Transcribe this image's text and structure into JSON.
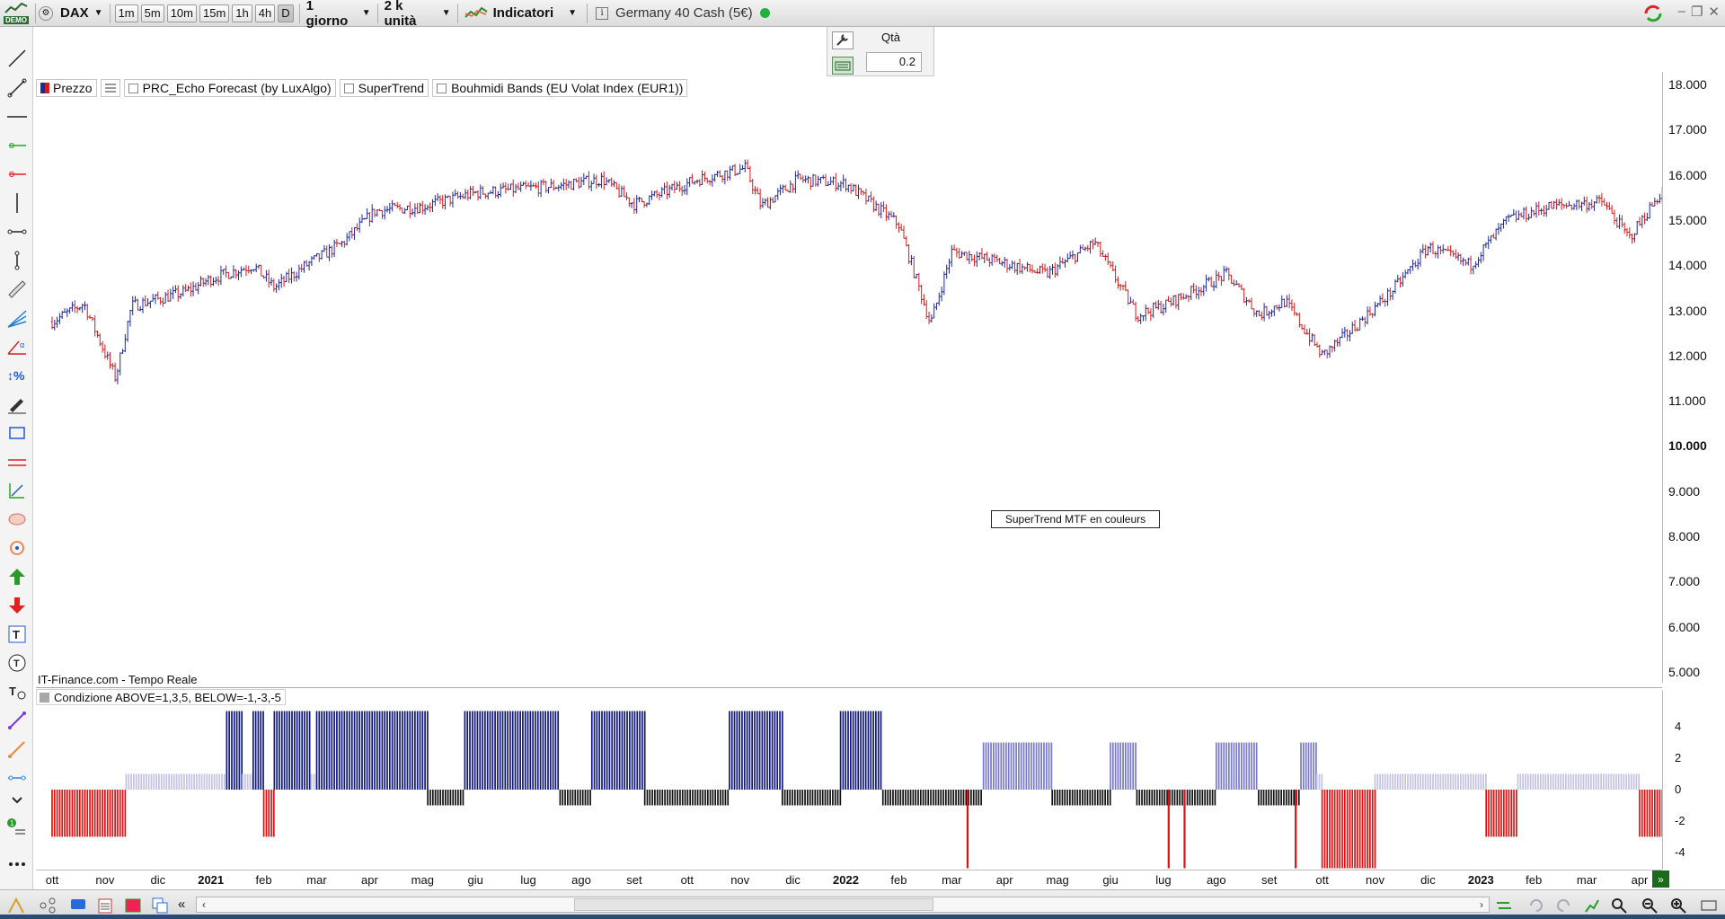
{
  "toolbar": {
    "logo_text": "DEMO",
    "instrument_dropdown": "DAX",
    "timeframes": [
      "1m",
      "5m",
      "10m",
      "15m",
      "1h",
      "4h",
      "D"
    ],
    "active_timeframe": "D",
    "period_dropdown": "1 giorno",
    "units_dropdown": "2 k unità",
    "indicators_label": "Indicatori",
    "instrument_name": "Germany 40 Cash (5€)",
    "status_color": "#22b13a"
  },
  "order_panel": {
    "qta_label": "Qtà",
    "qta_value": "0.2"
  },
  "legend": {
    "price_label": "Prezzo",
    "indicators": [
      "PRC_Echo Forecast (by LuxAlgo)",
      "SuperTrend",
      "Bouhmidi Bands (EU Volat Index (EUR1))"
    ]
  },
  "price_axis": [
    {
      "label": "18.000",
      "value": 18000
    },
    {
      "label": "17.000",
      "value": 17000
    },
    {
      "label": "16.000",
      "value": 16000
    },
    {
      "label": "15.000",
      "value": 15000
    },
    {
      "label": "14.000",
      "value": 14000
    },
    {
      "label": "13.000",
      "value": 13000
    },
    {
      "label": "12.000",
      "value": 12000
    },
    {
      "label": "11.000",
      "value": 11000
    },
    {
      "label": "10.000",
      "value": 10000
    },
    {
      "label": "9.000",
      "value": 9000
    },
    {
      "label": "8.000",
      "value": 8000
    },
    {
      "label": "7.000",
      "value": 7000
    },
    {
      "label": "6.000",
      "value": 6000
    },
    {
      "label": "5.000",
      "value": 5000
    }
  ],
  "supertrend_label": "SuperTrend MTF en couleurs",
  "source_label": "IT-Finance.com - Tempo Reale",
  "indicator_panel": {
    "label": "Condizione ABOVE=1,3,5, BELOW=-1,-3,-5",
    "axis": [
      {
        "label": "4",
        "value": 4
      },
      {
        "label": "2",
        "value": 2
      },
      {
        "label": "0",
        "value": 0
      },
      {
        "label": "-2",
        "value": -2
      },
      {
        "label": "-4",
        "value": -4
      }
    ]
  },
  "time_axis": [
    "ott",
    "nov",
    "dic",
    "2021",
    "feb",
    "mar",
    "apr",
    "mag",
    "giu",
    "lug",
    "ago",
    "set",
    "ott",
    "nov",
    "dic",
    "2022",
    "feb",
    "mar",
    "apr",
    "mag",
    "giu",
    "lug",
    "ago",
    "set",
    "ott",
    "nov",
    "dic",
    "2023",
    "feb",
    "mar",
    "apr"
  ],
  "colors": {
    "bull": "#1c2a9c",
    "bear": "#d21c1c",
    "cond_5": "#10187a",
    "cond_3": "#7a7ac8",
    "cond_1": "#c2c2e2",
    "cond_m1": "#111111",
    "cond_m3": "#e01010"
  },
  "chart_data": {
    "type": "candlestick",
    "anchors": [
      {
        "month": 0,
        "close": 12750
      },
      {
        "month": 0.6,
        "close": 13150
      },
      {
        "month": 1.2,
        "close": 11500
      },
      {
        "month": 1.5,
        "close": 13100
      },
      {
        "month": 2.5,
        "close": 13400
      },
      {
        "month": 3.0,
        "close": 13700
      },
      {
        "month": 3.8,
        "close": 14000
      },
      {
        "month": 4.2,
        "close": 13500
      },
      {
        "month": 4.8,
        "close": 14000
      },
      {
        "month": 5.5,
        "close": 14500
      },
      {
        "month": 6.1,
        "close": 15200
      },
      {
        "month": 7.0,
        "close": 15300
      },
      {
        "month": 8.0,
        "close": 15600
      },
      {
        "month": 9.5,
        "close": 15750
      },
      {
        "month": 10.4,
        "close": 15900
      },
      {
        "month": 11.0,
        "close": 15350
      },
      {
        "month": 12.2,
        "close": 15900
      },
      {
        "month": 13.1,
        "close": 16150
      },
      {
        "month": 13.4,
        "close": 15300
      },
      {
        "month": 14.1,
        "close": 15900
      },
      {
        "month": 15.0,
        "close": 15800
      },
      {
        "month": 16.0,
        "close": 14900
      },
      {
        "month": 16.6,
        "close": 12700
      },
      {
        "month": 17.0,
        "close": 14300
      },
      {
        "month": 17.8,
        "close": 14100
      },
      {
        "month": 18.8,
        "close": 13800
      },
      {
        "month": 19.7,
        "close": 14500
      },
      {
        "month": 20.5,
        "close": 12900
      },
      {
        "month": 21.0,
        "close": 13100
      },
      {
        "month": 22.2,
        "close": 13800
      },
      {
        "month": 22.8,
        "close": 12900
      },
      {
        "month": 23.3,
        "close": 13200
      },
      {
        "month": 24.0,
        "close": 12000
      },
      {
        "month": 24.4,
        "close": 12400
      },
      {
        "month": 25.3,
        "close": 13400
      },
      {
        "month": 26.0,
        "close": 14400
      },
      {
        "month": 26.8,
        "close": 14000
      },
      {
        "month": 27.5,
        "close": 15000
      },
      {
        "month": 28.3,
        "close": 15300
      },
      {
        "month": 29.3,
        "close": 15400
      },
      {
        "month": 29.8,
        "close": 14600
      },
      {
        "month": 30.4,
        "close": 15600
      },
      {
        "month": 30.9,
        "close": 15800
      }
    ],
    "condition_segments": [
      {
        "from": 0,
        "to": 1.4,
        "value": -3
      },
      {
        "from": 1.4,
        "to": 3.3,
        "value": 1
      },
      {
        "from": 3.3,
        "to": 3.6,
        "value": 5
      },
      {
        "from": 3.6,
        "to": 3.8,
        "value": 1
      },
      {
        "from": 3.8,
        "to": 4.0,
        "value": 5
      },
      {
        "from": 4.0,
        "to": 4.2,
        "value": -3
      },
      {
        "from": 4.2,
        "to": 4.9,
        "value": 5
      },
      {
        "from": 4.9,
        "to": 5.0,
        "value": 1
      },
      {
        "from": 5.0,
        "to": 7.1,
        "value": 5
      },
      {
        "from": 7.1,
        "to": 7.8,
        "value": -1
      },
      {
        "from": 7.8,
        "to": 9.6,
        "value": 5
      },
      {
        "from": 9.6,
        "to": 10.2,
        "value": -1
      },
      {
        "from": 10.2,
        "to": 11.2,
        "value": 5
      },
      {
        "from": 11.2,
        "to": 12.8,
        "value": -1
      },
      {
        "from": 12.8,
        "to": 13.8,
        "value": 5
      },
      {
        "from": 13.8,
        "to": 14.9,
        "value": -1
      },
      {
        "from": 14.9,
        "to": 15.7,
        "value": 5
      },
      {
        "from": 15.7,
        "to": 17.6,
        "value": -1
      },
      {
        "from": 17.6,
        "to": 18.9,
        "value": 3
      },
      {
        "from": 18.9,
        "to": 20.0,
        "value": -1
      },
      {
        "from": 20.0,
        "to": 20.5,
        "value": 3
      },
      {
        "from": 20.5,
        "to": 22.0,
        "value": -1
      },
      {
        "from": 22.0,
        "to": 22.8,
        "value": 3
      },
      {
        "from": 22.8,
        "to": 23.6,
        "value": -1
      },
      {
        "from": 23.6,
        "to": 23.9,
        "value": 3
      },
      {
        "from": 23.9,
        "to": 24.0,
        "value": 1
      },
      {
        "from": 24.0,
        "to": 25.0,
        "value": -5
      },
      {
        "from": 25.0,
        "to": 27.1,
        "value": 1
      },
      {
        "from": 27.1,
        "to": 27.7,
        "value": -3
      },
      {
        "from": 27.7,
        "to": 30.0,
        "value": 1
      },
      {
        "from": 30.0,
        "to": 30.6,
        "value": -3
      },
      {
        "from": 30.6,
        "to": 31.3,
        "value": 1
      }
    ],
    "condition_spikes": [
      {
        "month": 17.3,
        "value": -5
      },
      {
        "month": 21.1,
        "value": -5
      },
      {
        "month": 21.4,
        "value": -5
      },
      {
        "month": 23.5,
        "value": -5
      }
    ],
    "ylim": [
      5000,
      18000
    ],
    "indicator_ylim": [
      -5.5,
      5.5
    ]
  }
}
